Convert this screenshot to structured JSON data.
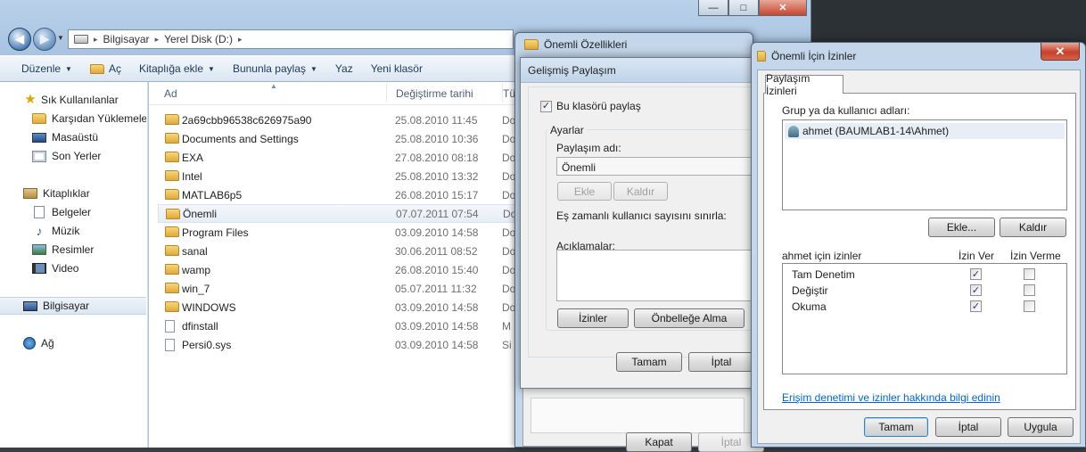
{
  "explorer": {
    "caption": {
      "minimize": "—",
      "maximize": "□",
      "close": "✕"
    },
    "address": [
      "Bilgisayar",
      "Yerel Disk (D:)"
    ],
    "toolbar": {
      "organize": "Düzenle",
      "open": "Aç",
      "add_library": "Kitaplığa ekle",
      "share": "Bununla paylaş",
      "burn": "Yaz",
      "new_folder": "Yeni klasör"
    },
    "nav": {
      "favorites": "Sık Kullanılanlar",
      "downloads": "Karşıdan Yüklemeler",
      "desktop": "Masaüstü",
      "recent": "Son Yerler",
      "libraries": "Kitaplıklar",
      "documents": "Belgeler",
      "music": "Müzik",
      "pictures": "Resimler",
      "video": "Video",
      "computer": "Bilgisayar",
      "network": "Ağ"
    },
    "columns": {
      "name": "Ad",
      "date": "Değiştirme tarihi",
      "type": "Tü"
    },
    "files": [
      {
        "name": "2a69cbb96538c626975a90",
        "date": "25.08.2010 11:45",
        "type": "Do",
        "kind": "folder"
      },
      {
        "name": "Documents and Settings",
        "date": "25.08.2010 10:36",
        "type": "Do",
        "kind": "folder"
      },
      {
        "name": "EXA",
        "date": "27.08.2010 08:18",
        "type": "Do",
        "kind": "folder"
      },
      {
        "name": "Intel",
        "date": "25.08.2010 13:32",
        "type": "Do",
        "kind": "folder"
      },
      {
        "name": "MATLAB6p5",
        "date": "26.08.2010 15:17",
        "type": "Do",
        "kind": "folder"
      },
      {
        "name": "Önemli",
        "date": "07.07.2011 07:54",
        "type": "Do",
        "kind": "folder"
      },
      {
        "name": "Program Files",
        "date": "03.09.2010 14:58",
        "type": "Do",
        "kind": "folder"
      },
      {
        "name": "sanal",
        "date": "30.06.2011 08:52",
        "type": "Do",
        "kind": "folder"
      },
      {
        "name": "wamp",
        "date": "26.08.2010 15:40",
        "type": "Do",
        "kind": "folder"
      },
      {
        "name": "win_7",
        "date": "05.07.2011 11:32",
        "type": "Do",
        "kind": "folder"
      },
      {
        "name": "WINDOWS",
        "date": "03.09.2010 14:58",
        "type": "Do",
        "kind": "folder"
      },
      {
        "name": "dfinstall",
        "date": "03.09.2010 14:58",
        "type": "M",
        "kind": "file"
      },
      {
        "name": "Persi0.sys",
        "date": "03.09.2010 14:58",
        "type": "Si",
        "kind": "file"
      }
    ]
  },
  "props": {
    "title": "Önemli Özellikleri",
    "close_btn": "Kapat",
    "cancel_btn": "İptal"
  },
  "adv": {
    "title": "Gelişmiş Paylaşım",
    "share_checkbox": "Bu klasörü paylaş",
    "settings_group": "Ayarlar",
    "share_name_label": "Paylaşım adı:",
    "share_name_value": "Önemli",
    "add_btn": "Ekle",
    "remove_btn": "Kaldır",
    "limit_label": "Eş zamanlı kullanıcı sayısını sınırla:",
    "comments_label": "Açıklamalar:",
    "permissions_btn": "İzinler",
    "caching_btn": "Önbelleğe Alma",
    "ok_btn": "Tamam",
    "cancel_btn": "İptal"
  },
  "perm": {
    "title": "Önemli İçin İzinler",
    "close": "✕",
    "tab": "Paylaşım İzinleri",
    "group_label": "Grup ya da kullanıcı adları:",
    "users": [
      "ahmet (BAUMLAB1-14\\Ahmet)"
    ],
    "add_btn": "Ekle...",
    "remove_btn": "Kaldır",
    "perm_for": "ahmet için izinler",
    "allow_col": "İzin Ver",
    "deny_col": "İzin Verme",
    "rows": [
      {
        "name": "Tam Denetim",
        "allow": true,
        "deny": false
      },
      {
        "name": "Değiştir",
        "allow": true,
        "deny": false
      },
      {
        "name": "Okuma",
        "allow": true,
        "deny": false
      }
    ],
    "link": "Erişim denetimi ve izinler hakkında bilgi edinin",
    "ok_btn": "Tamam",
    "cancel_btn": "İptal",
    "apply_btn": "Uygula"
  }
}
